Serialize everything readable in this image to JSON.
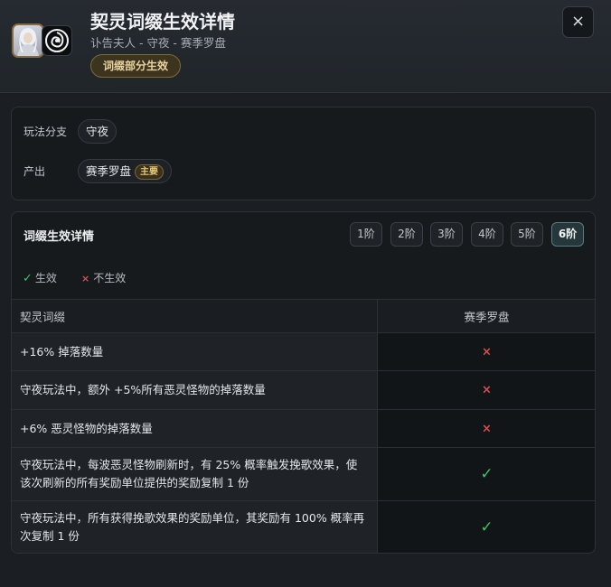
{
  "header": {
    "title": "契灵词缀生效详情",
    "subtitle": "讣告夫人 - 守夜 - 赛季罗盘",
    "status": "词缀部分生效",
    "close_icon": "×"
  },
  "info": {
    "branch_label": "玩法分支",
    "branch_value": "守夜",
    "output_label": "产出",
    "output_value": "赛季罗盘",
    "output_tag": "主要"
  },
  "detail": {
    "title": "词缀生效详情",
    "tiers": [
      "1阶",
      "2阶",
      "3阶",
      "4阶",
      "5阶",
      "6阶"
    ],
    "active_tier": "6阶",
    "legend": {
      "ok_icon": "✓",
      "ok_label": "生效",
      "no_icon": "×",
      "no_label": "不生效"
    },
    "table": {
      "col1": "契灵词缀",
      "col2": "赛季罗盘",
      "rows": [
        {
          "text": "+16% 掉落数量",
          "effective": false,
          "mark": "×"
        },
        {
          "text": "守夜玩法中，额外 +5%所有恶灵怪物的掉落数量",
          "effective": false,
          "mark": "×"
        },
        {
          "text": "+6% 恶灵怪物的掉落数量",
          "effective": false,
          "mark": "×"
        },
        {
          "text": "守夜玩法中，每波恶灵怪物刷新时，有 25% 概率触发挽歌效果，使该次刷新的所有奖励单位提供的奖励复制 1 份",
          "effective": true,
          "mark": "✓"
        },
        {
          "text": "守夜玩法中，所有获得挽歌效果的奖励单位，其奖励有 100% 概率再次复制 1 份",
          "effective": true,
          "mark": "✓"
        }
      ]
    }
  },
  "colors": {
    "accent_green": "#3fbf6a",
    "accent_red": "#d94f4f",
    "gold": "#e9d49e"
  }
}
